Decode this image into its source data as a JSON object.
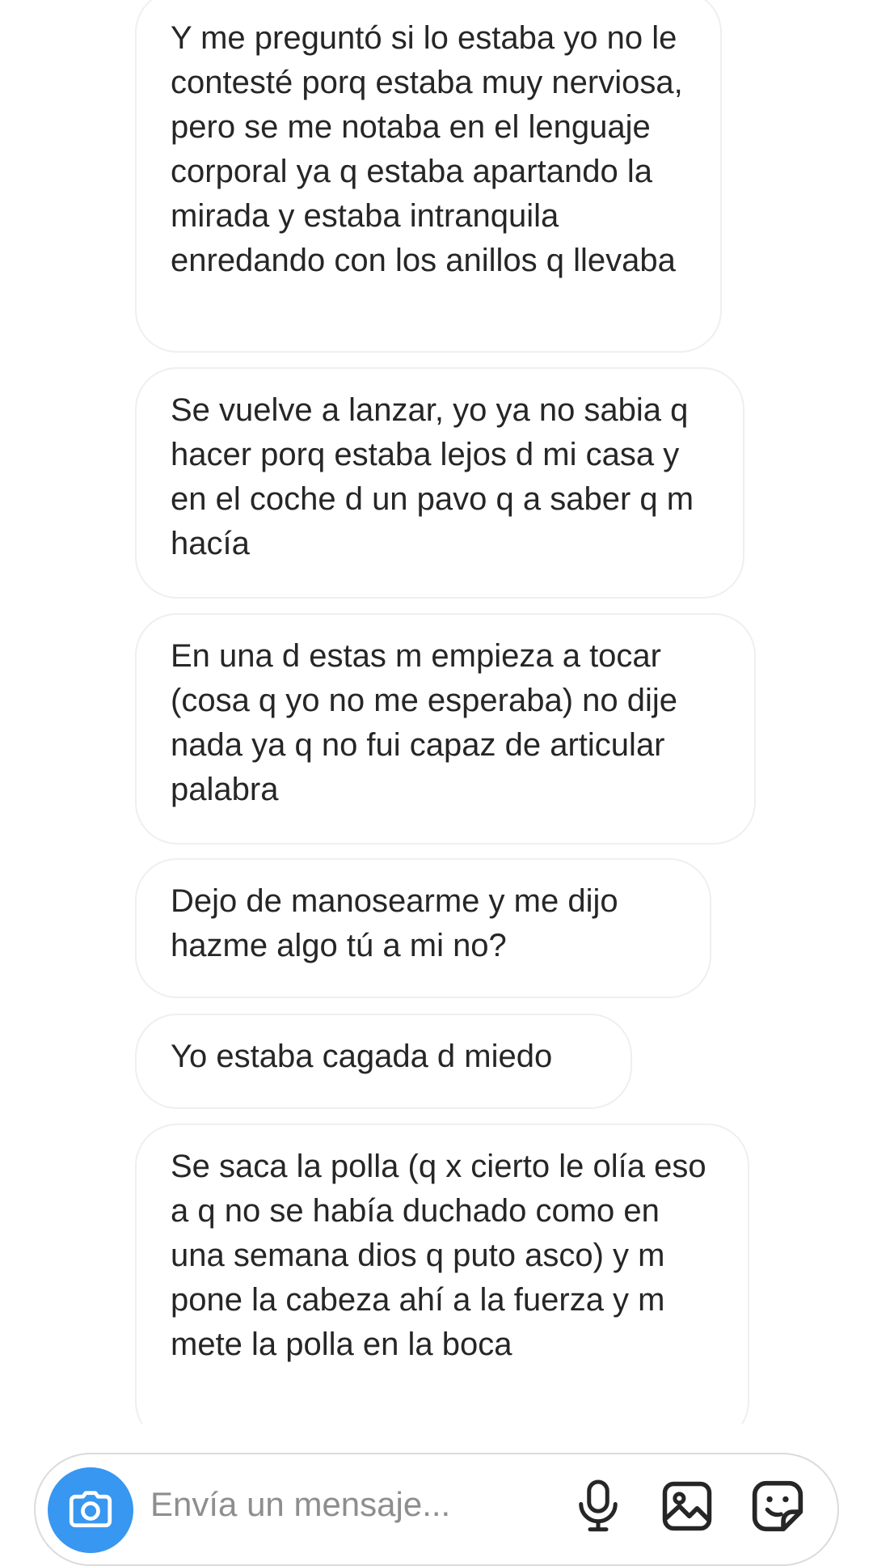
{
  "messages": [
    {
      "text": "Y me preguntó si lo estaba yo no le contesté porq estaba muy nerviosa, pero se me notaba en el lenguaje corporal ya q estaba apartando la mirada y estaba intranquila enredando con los anillos q llevaba"
    },
    {
      "text": "Se vuelve a lanzar, yo ya no sabia q hacer porq estaba lejos d mi casa y en el coche d un pavo q a saber q m hacía"
    },
    {
      "text": "En una d estas m empieza a tocar (cosa q yo no me esperaba) no dije nada ya q no fui capaz de articular palabra"
    },
    {
      "text": "Dejo de manosearme y me dijo hazme algo tú a mi no?"
    },
    {
      "text": "Yo estaba cagada d miedo"
    },
    {
      "text": "Se saca la polla (q x cierto le olía eso a q no se había duchado como en una semana dios q puto asco) y m pone la cabeza ahí a la fuerza y m mete la polla en la boca"
    }
  ],
  "composer": {
    "placeholder": "Envía un mensaje...",
    "value": "",
    "camera_icon": "camera-icon",
    "mic_icon": "microphone-icon",
    "gallery_icon": "gallery-icon",
    "sticker_icon": "sticker-icon",
    "accent_color": "#3897f0"
  }
}
